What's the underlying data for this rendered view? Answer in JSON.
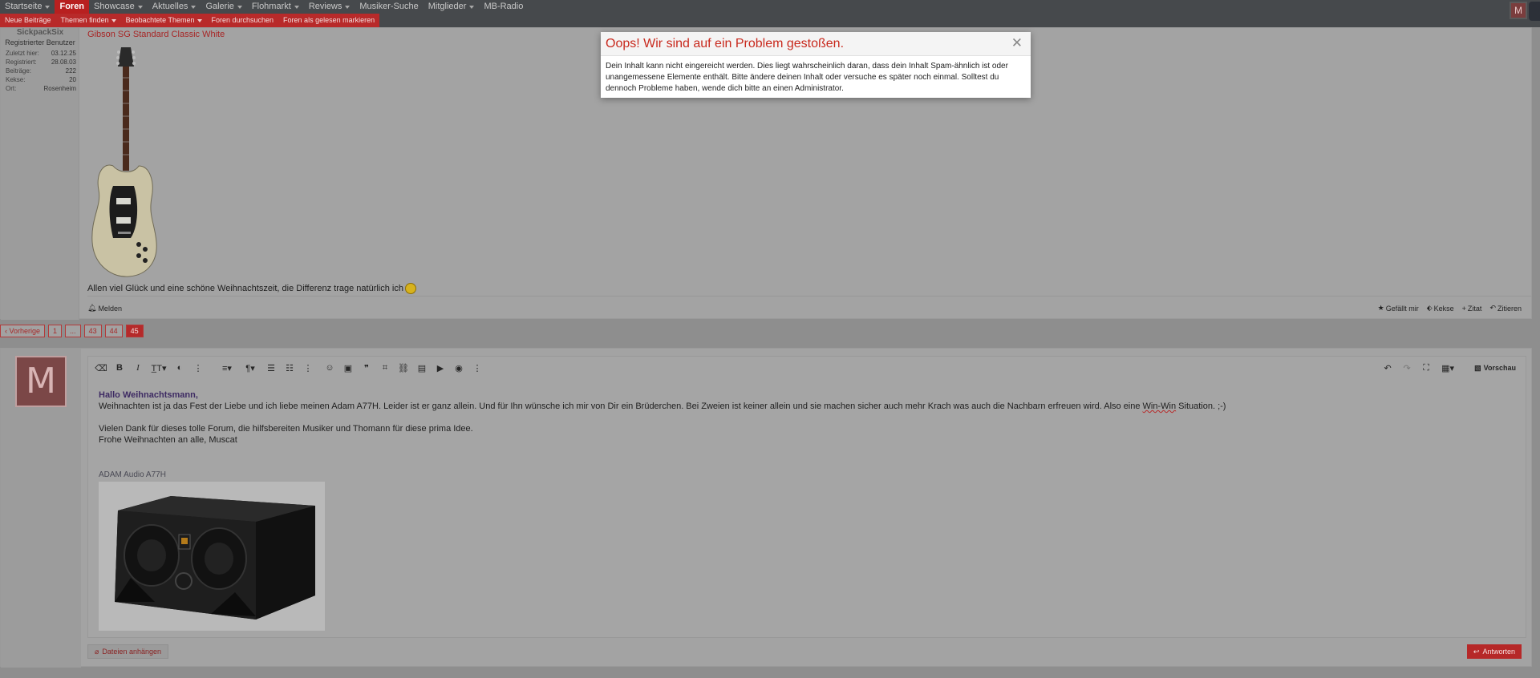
{
  "nav": {
    "items": [
      {
        "label": "Startseite",
        "caret": true
      },
      {
        "label": "Foren",
        "caret": false,
        "active": true
      },
      {
        "label": "Showcase",
        "caret": true
      },
      {
        "label": "Aktuelles",
        "caret": true
      },
      {
        "label": "Galerie",
        "caret": true
      },
      {
        "label": "Flohmarkt",
        "caret": true
      },
      {
        "label": "Reviews",
        "caret": true
      },
      {
        "label": "Musiker-Suche",
        "caret": false
      },
      {
        "label": "Mitglieder",
        "caret": true
      },
      {
        "label": "MB-Radio",
        "caret": false
      }
    ],
    "avatar_letter": "M"
  },
  "subnav": {
    "new_posts": "Neue Beiträge",
    "find_threads": "Themen finden",
    "watched_threads": "Beobachtete Themen",
    "search_forums": "Foren durchsuchen",
    "mark_read": "Foren als gelesen markieren"
  },
  "post": {
    "author": "SickpackSix",
    "user_title": "Registrierter Benutzer",
    "stats": [
      {
        "key": "Zuletzt hier:",
        "value": "03.12.25"
      },
      {
        "key": "Registriert:",
        "value": "28.08.03"
      },
      {
        "key": "Beiträge:",
        "value": "222"
      },
      {
        "key": "Kekse:",
        "value": "20"
      },
      {
        "key": "Ort:",
        "value": "Rosenheim"
      }
    ],
    "image_title": "Gibson SG Standard Classic White",
    "text": "Allen viel Glück und eine schöne Weihnachtszeit, die Differenz trage natürlich ich",
    "report": "Melden",
    "actions": {
      "like": "Gefällt mir",
      "cookies": "Kekse",
      "quote_plus": "Zitat",
      "quote": "Zitieren"
    }
  },
  "pagination": {
    "prev": "Vorherige",
    "pages": [
      "1",
      "...",
      "43",
      "44",
      "45"
    ],
    "current": "45"
  },
  "editor": {
    "avatar_letter": "M",
    "preview": "Vorschau",
    "greeting": "Hallo Weihnachtsmann,",
    "line1_pre": "Weihnachten ist ja das Fest der Liebe und ich liebe meinen Adam A77H. Leider ist er ganz allein. Und für Ihn wünsche ich mir von Dir ein Brüderchen. Bei Zweien ist keiner allein und sie machen sicher auch mehr Krach was auch die Nachbarn erfreuen wird. Also eine ",
    "line1_squiggle": "Win-Win",
    "line1_post": " Situation. ;-)",
    "line2": "Vielen Dank für dieses tolle Forum, die hilfsbereiten Musiker und Thomann für diese prima Idee.",
    "line3": "Frohe Weihnachten an alle, Muscat",
    "image_caption": "ADAM Audio A77H",
    "attach": "Dateien anhängen",
    "reply": "Antworten"
  },
  "modal": {
    "title": "Oops! Wir sind auf ein Problem gestoßen.",
    "body": "Dein Inhalt kann nicht eingereicht werden. Dies liegt wahrscheinlich daran, dass dein Inhalt Spam-ähnlich ist oder unangemessene Elemente enthält. Bitte ändere deinen Inhalt oder versuche es später noch einmal. Solltest du dennoch Probleme haben, wende dich bitte an einen Administrator."
  }
}
